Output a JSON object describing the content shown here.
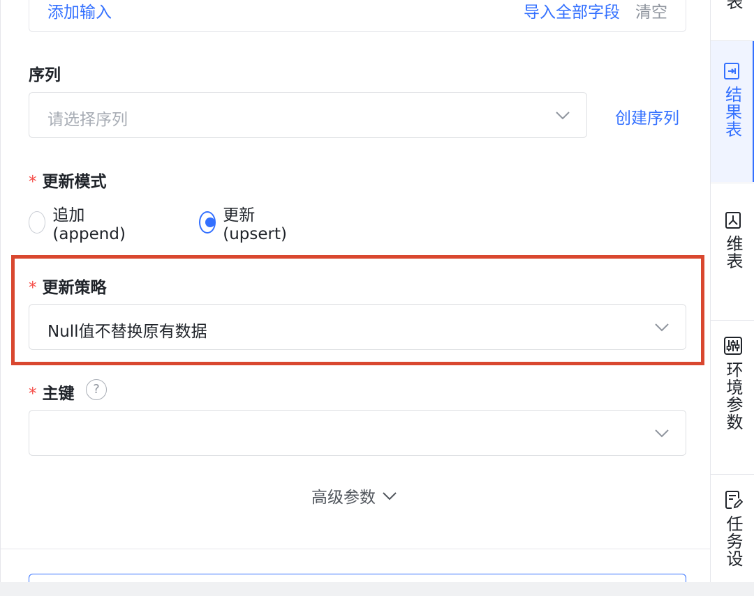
{
  "inputs": {
    "add_label": "添加输入",
    "import_all_label": "导入全部字段",
    "clear_label": "清空"
  },
  "sequence": {
    "label": "序列",
    "placeholder": "请选择序列",
    "create_label": "创建序列"
  },
  "update_mode": {
    "required_mark": "*",
    "label": "更新模式",
    "options": [
      {
        "label": "追加(append)",
        "checked": false
      },
      {
        "label": "更新(upsert)",
        "checked": true
      }
    ]
  },
  "update_strategy": {
    "required_mark": "*",
    "label": "更新策略",
    "value": "Null值不替换原有数据"
  },
  "primary_key": {
    "required_mark": "*",
    "label": "主键",
    "help_glyph": "?",
    "value": ""
  },
  "advanced": {
    "label": "高级参数"
  },
  "sidebar": {
    "top_tab_partial": "表",
    "tabs": [
      {
        "label": "结果表",
        "active": true
      },
      {
        "label": "维表",
        "active": false
      },
      {
        "label": "环境参数",
        "active": false
      },
      {
        "label": "任务设",
        "active": false
      }
    ]
  },
  "colors": {
    "accent": "#3370ff",
    "required": "#f54a45",
    "highlight_border": "#d9472f"
  }
}
